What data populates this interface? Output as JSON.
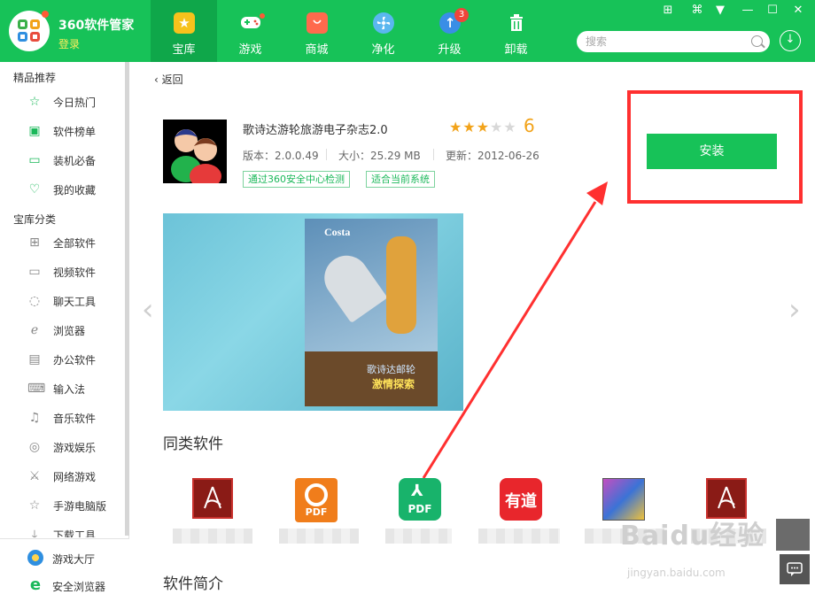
{
  "app": {
    "title": "360软件管家",
    "login": "登录"
  },
  "nav": {
    "tabs": [
      {
        "label": "宝库",
        "icon": "star-icon",
        "active": true
      },
      {
        "label": "游戏",
        "icon": "gamepad-icon"
      },
      {
        "label": "商城",
        "icon": "shopping-bag-icon"
      },
      {
        "label": "净化",
        "icon": "fan-icon"
      },
      {
        "label": "升级",
        "icon": "upgrade-arrow-icon",
        "badge": "3"
      },
      {
        "label": "卸载",
        "icon": "trash-icon"
      }
    ]
  },
  "search": {
    "placeholder": "搜索"
  },
  "sidebar": {
    "section1": "精品推荐",
    "items1": [
      {
        "label": "今日热门",
        "icon": "star-outline-icon"
      },
      {
        "label": "软件榜单",
        "icon": "ranking-icon"
      },
      {
        "label": "装机必备",
        "icon": "monitor-icon"
      },
      {
        "label": "我的收藏",
        "icon": "heart-icon"
      }
    ],
    "section2": "宝库分类",
    "items2": [
      {
        "label": "全部软件",
        "icon": "grid-icon"
      },
      {
        "label": "视频软件",
        "icon": "video-icon"
      },
      {
        "label": "聊天工具",
        "icon": "chat-icon"
      },
      {
        "label": "浏览器",
        "icon": "browser-icon"
      },
      {
        "label": "办公软件",
        "icon": "briefcase-icon"
      },
      {
        "label": "输入法",
        "icon": "keyboard-icon"
      },
      {
        "label": "音乐软件",
        "icon": "music-icon"
      },
      {
        "label": "游戏娱乐",
        "icon": "gamepad-icon"
      },
      {
        "label": "网络游戏",
        "icon": "sword-icon"
      },
      {
        "label": "手游电脑版",
        "icon": "star-outline-icon"
      },
      {
        "label": "下载工具",
        "icon": "download-icon"
      }
    ],
    "bottom": [
      {
        "label": "游戏大厅",
        "icon": "game-hall-icon"
      },
      {
        "label": "安全浏览器",
        "icon": "ie-browser-icon"
      }
    ]
  },
  "detail": {
    "back": "返回",
    "name": "歌诗达游轮旅游电子杂志2.0",
    "rating": 3,
    "rating_max": 5,
    "score": "6",
    "version": "版本：2.0.0.49",
    "size": "大小：25.29 MB",
    "updated": "更新：2012-06-26",
    "tags": [
      "通过360安全中心检测",
      "适合当前系统"
    ],
    "install": "安装",
    "cover_brand": "Costa",
    "cover_caption_1": "歌诗达邮轮",
    "cover_caption_2": "激情探索"
  },
  "sections": {
    "similar": "同类软件",
    "intro": "软件简介"
  },
  "similar": [
    {
      "icon": "adobe-reader-icon"
    },
    {
      "icon": "foxit-pdf-icon",
      "text": "PDF"
    },
    {
      "icon": "green-pdf-icon",
      "text": "PDF"
    },
    {
      "icon": "youdao-icon",
      "text": "有道"
    },
    {
      "icon": "winrar-icon"
    },
    {
      "icon": "adobe-reader-icon"
    }
  ],
  "watermark": {
    "main": "Baidu经验",
    "sub": "jingyan.baidu.com"
  },
  "colors": {
    "brand": "#17c258",
    "accent": "#f2a31a",
    "highlight": "#ff3030"
  }
}
